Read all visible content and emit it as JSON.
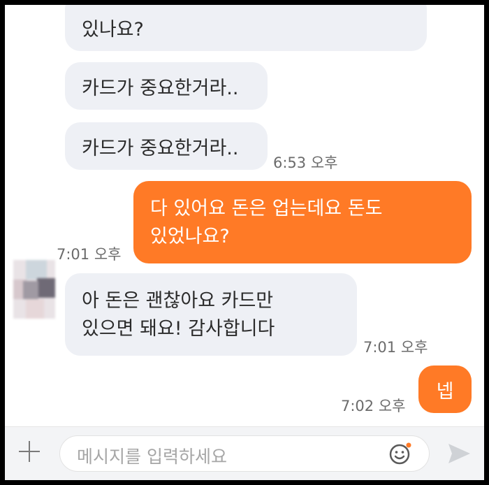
{
  "messages": [
    {
      "id": "m1",
      "from": "other",
      "text": "있나요?"
    },
    {
      "id": "m2",
      "from": "other",
      "text": "카드가 중요한거라.."
    },
    {
      "id": "m3",
      "from": "other",
      "text": "카드가 중요한거라..",
      "time": "6:53 오후"
    },
    {
      "id": "m4",
      "from": "me",
      "lines": [
        "다 있어요 돈은 업는데요  돈도",
        "있었나요?"
      ],
      "time": "7:01 오후"
    },
    {
      "id": "m5",
      "from": "other",
      "lines": [
        "아 돈은 괜찮아요 카드만",
        "있으면 돼요! 감사합니다"
      ],
      "time": "7:01 오후"
    },
    {
      "id": "m6",
      "from": "me",
      "text": "넵",
      "time": "7:02 오후"
    }
  ],
  "composer": {
    "placeholder": "메시지를 입력하세요",
    "add_icon": "plus-icon",
    "emoji_icon": "smiley-icon",
    "send_icon": "send-arrow-icon"
  },
  "colors": {
    "accent": "#ff7a26",
    "incoming_bubble": "#eef0f5",
    "background": "#ffffff",
    "frame": "#000000"
  }
}
